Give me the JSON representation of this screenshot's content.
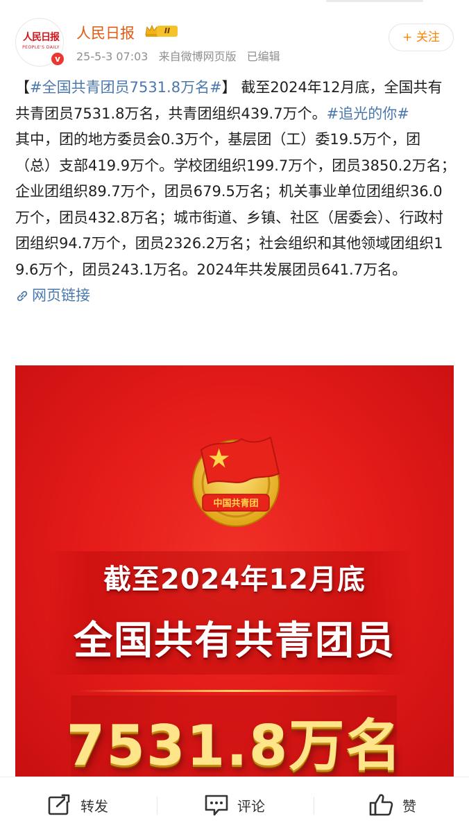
{
  "account": {
    "avatar_text": "人民日报",
    "avatar_subtext": "PEOPLE'S DAILY",
    "name": "人民日报",
    "vip_level": "II",
    "verified_mark": "v",
    "timestamp": "25-5-3 07:03",
    "source": "来自微博网页版",
    "edited": "已编辑",
    "follow_label": "+ 关注"
  },
  "post": {
    "topic1": "#全国共青团员7531.8万名#",
    "bracket_open": "【",
    "bracket_close": "】",
    "para1_text": "截至2024年12月底，全国共有共青团员7531.8万名，共青团组织439.7万个。",
    "topic2": "#追光的你#",
    "para2": "其中，团的地方委员会0.3万个，基层团（工）委19.5万个，团（总）支部419.9万个。学校团组织199.7万个，团员3850.2万名；企业团组织89.7万个，团员679.5万名；机关事业单位团组织36.0万个，团员432.8万名；城市街道、乡镇、社区（居委会）、行政村团组织94.7万个，团员2326.2万名；社会组织和其他领域团组织19.6万个，团员243.1万名。2024年共发展团员641.7万名。",
    "link_label": "网页链接"
  },
  "image": {
    "emblem_text": "中国共青团",
    "line1": "截至2024年12月底",
    "line2": "全国共有共青团员",
    "number": "7531.8万名"
  },
  "actions": {
    "repost_label": "转发",
    "comment_label": "评论",
    "like_label": "赞"
  },
  "colors": {
    "brand_name": "#e15a12",
    "link": "#4a78ad",
    "follow": "#ff8200",
    "poster_red": "#e51c1a",
    "poster_gold": "#ffe58a"
  },
  "icons": [
    "crown-icon",
    "verified-icon",
    "link-icon",
    "repost-icon",
    "comment-icon",
    "like-icon",
    "emblem-icon"
  ]
}
